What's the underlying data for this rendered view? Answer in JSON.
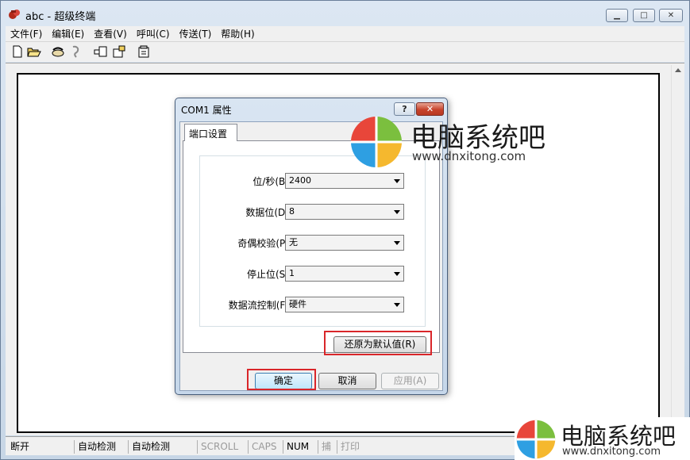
{
  "window": {
    "title": "abc - 超级终端",
    "minimize_glyph": "▁",
    "maximize_glyph": "□",
    "close_glyph": "✕"
  },
  "menu": [
    "文件(F)",
    "编辑(E)",
    "查看(V)",
    "呼叫(C)",
    "传送(T)",
    "帮助(H)"
  ],
  "toolbar_icons": [
    "new-icon",
    "open-icon",
    "connect-icon",
    "disconnect-icon",
    "send-icon",
    "receive-icon",
    "properties-icon"
  ],
  "status_bar": [
    "断开",
    "自动检测",
    "自动检测",
    "SCROLL",
    "CAPS",
    "NUM",
    "捕",
    "打印"
  ],
  "dialog": {
    "title": "COM1 属性",
    "help_label": "?",
    "close_label": "✕",
    "tab_label": "端口设置",
    "fields": [
      {
        "label": "位/秒(B):",
        "value": "2400"
      },
      {
        "label": "数据位(D):",
        "value": "8"
      },
      {
        "label": "奇偶校验(P):",
        "value": "无"
      },
      {
        "label": "停止位(S):",
        "value": "1"
      },
      {
        "label": "数据流控制(F):",
        "value": "硬件"
      }
    ],
    "restore_defaults_label": "还原为默认值(R)",
    "ok_label": "确定",
    "cancel_label": "取消",
    "apply_label": "应用(A)"
  },
  "watermark": {
    "brand": "电脑系统吧",
    "url": "www.dnxitong.com",
    "colors": [
      "#e8463a",
      "#7bbf3e",
      "#2e9fe2",
      "#f5b82e"
    ]
  }
}
